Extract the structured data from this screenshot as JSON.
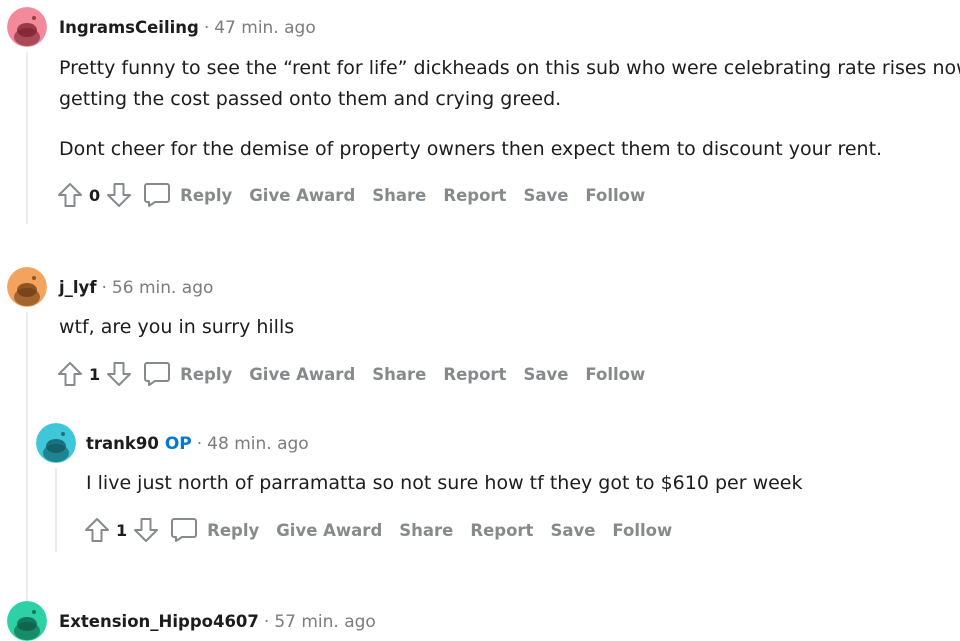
{
  "comments": [
    {
      "author": "IngramsCeiling",
      "time": "47 min. ago",
      "avatar_color": "#f28a9c",
      "paragraphs": [
        "Pretty funny to see the “rent for life” dickheads on this sub who were celebrating rate rises now",
        "getting the cost passed onto them and crying greed.",
        "Dont cheer for the demise of property owners then expect them to discount your rent."
      ],
      "score": "0"
    },
    {
      "author": "j_lyf",
      "time": "56 min. ago",
      "avatar_color": "#f4a35e",
      "paragraphs": [
        "wtf, are you in surry hills"
      ],
      "score": "1"
    },
    {
      "author": "trank90",
      "op_badge": "OP",
      "time": "48 min. ago",
      "avatar_color": "#3ec7d8",
      "paragraphs": [
        "I live just north of parramatta so not sure how tf they got to $610 per week"
      ],
      "score": "1"
    },
    {
      "author": "Extension_Hippo4607",
      "time": "57 min. ago",
      "avatar_color": "#2ed1a4"
    }
  ],
  "actions": {
    "reply": "Reply",
    "give_award": "Give Award",
    "share": "Share",
    "report": "Report",
    "save": "Save",
    "follow": "Follow"
  },
  "separator": "·",
  "icons": [
    "upvote-icon",
    "downvote-icon",
    "reply-icon",
    "snoo-avatar-icon"
  ]
}
